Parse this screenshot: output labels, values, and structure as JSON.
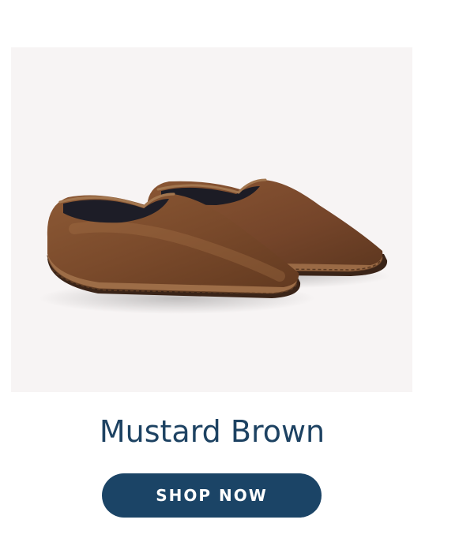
{
  "product": {
    "name": "Mustard Brown",
    "image_subject": "brown-velvet-slippers-photo"
  },
  "cta": {
    "label": "SHOP NOW"
  },
  "colors": {
    "title": "#1d4262",
    "button_bg": "#1b4466",
    "button_text": "#ffffff",
    "image_bg": "#f7f4f4",
    "slipper_velvet": "#7a4a2a"
  }
}
